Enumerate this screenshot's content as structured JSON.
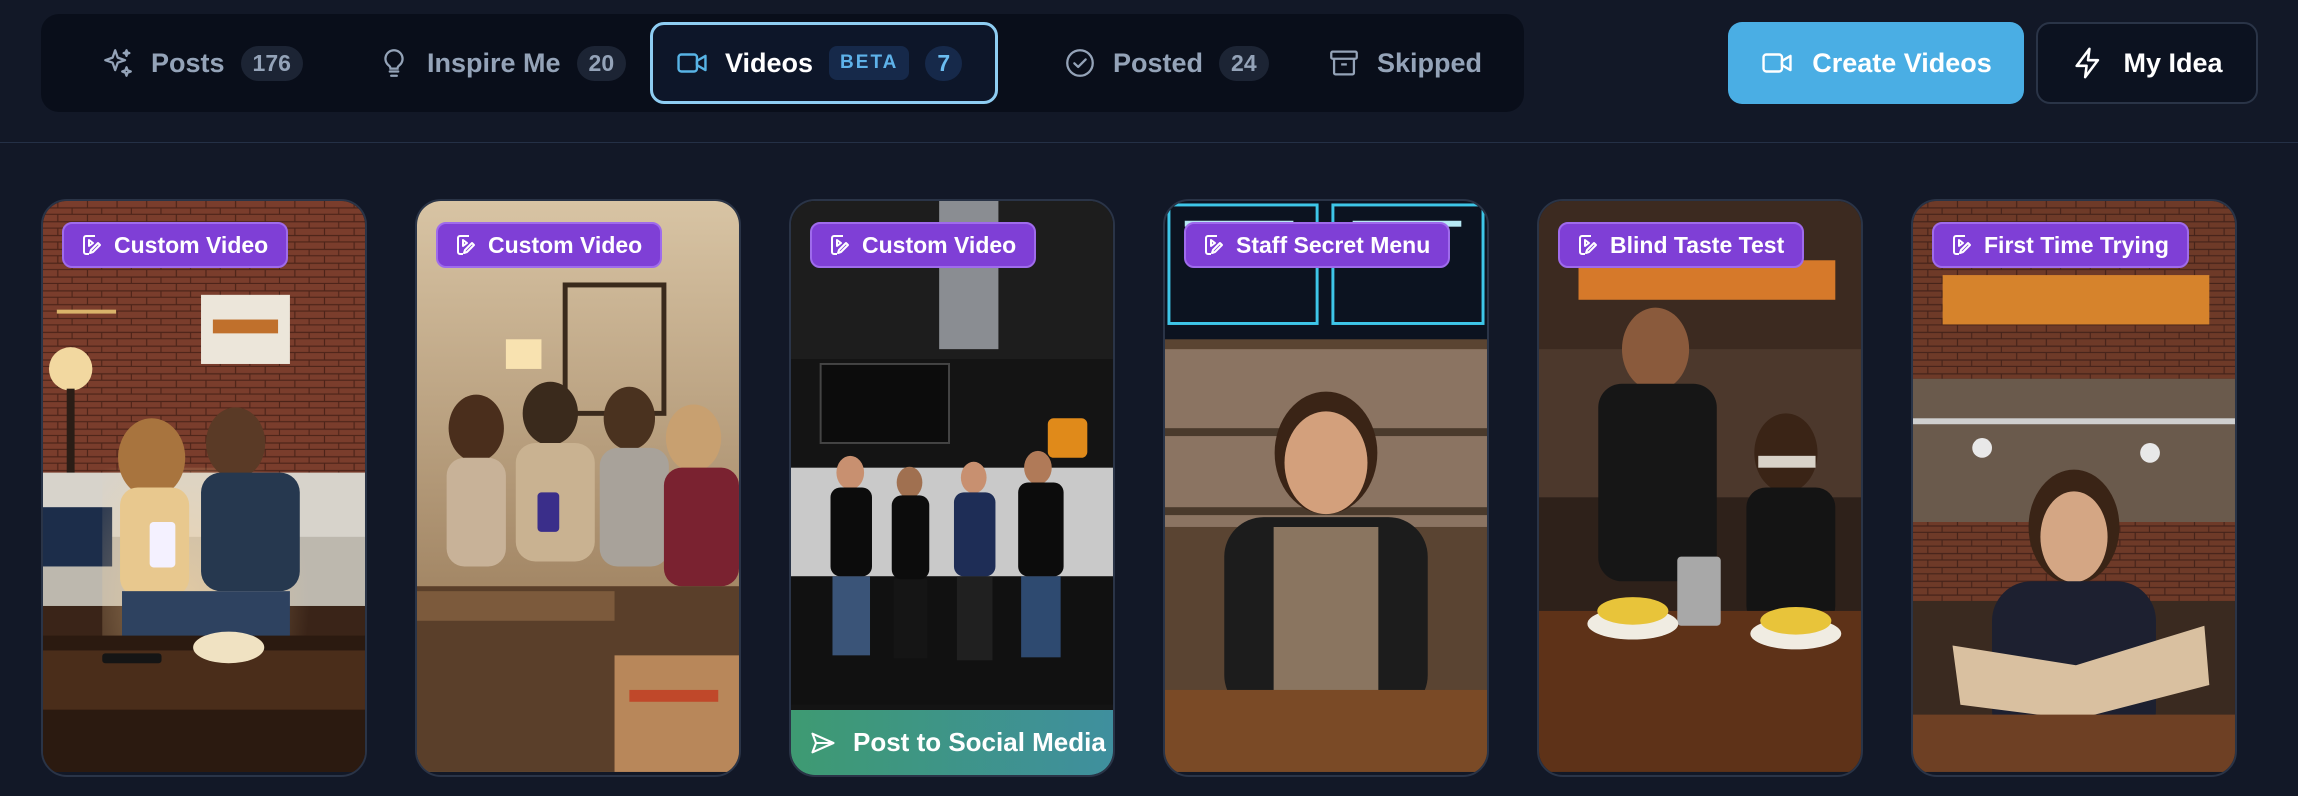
{
  "tabs": [
    {
      "label": "Posts",
      "count": "176",
      "icon": "sparkles-icon"
    },
    {
      "label": "Inspire Me",
      "count": "20",
      "icon": "lightbulb-icon"
    },
    {
      "label": "Videos",
      "badge": "BETA",
      "count": "7",
      "icon": "video-camera-icon",
      "active": true
    },
    {
      "label": "Posted",
      "count": "24",
      "icon": "check-circle-icon"
    },
    {
      "label": "Skipped",
      "icon": "archive-icon"
    }
  ],
  "actions": {
    "create_videos": "Create Videos",
    "my_idea": "My Idea"
  },
  "cards": [
    {
      "badge": "Custom Video",
      "image": "friends-on-couch-phone-photo"
    },
    {
      "badge": "Custom Video",
      "image": "friends-reacting-living-room-photo"
    },
    {
      "badge": "Custom Video",
      "image": "team-waving-restaurant-photo",
      "action": "Post to Social Media"
    },
    {
      "badge": "Staff Secret Menu",
      "image": "smiling-staff-apron-photo"
    },
    {
      "badge": "Blind Taste Test",
      "image": "blindfolded-taste-test-photo"
    },
    {
      "badge": "First Time Trying",
      "image": "woman-reading-menu-photo"
    }
  ],
  "colors": {
    "background": "#121827",
    "tab_bar": "#090e1a",
    "accent": "#4aaee4",
    "badge_purple": "#7f3fd6",
    "post_green": "#3e9a72"
  }
}
